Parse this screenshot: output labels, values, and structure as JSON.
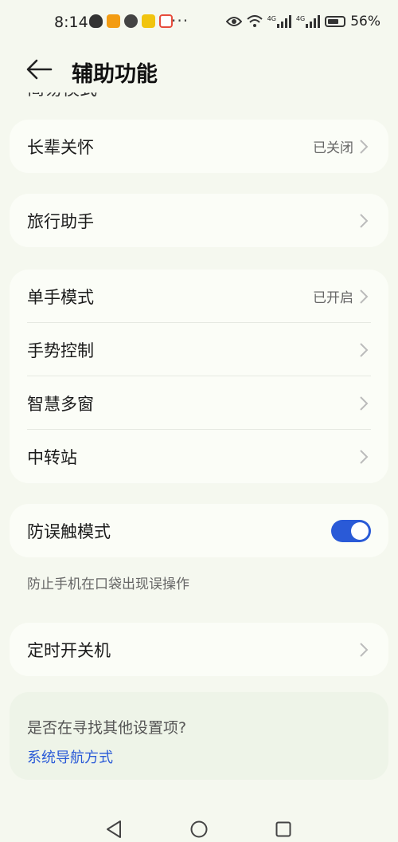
{
  "status_bar": {
    "time": "8:14",
    "dots": "···",
    "net1": "4G",
    "net2": "4G",
    "battery": "56%"
  },
  "header": {
    "title": "辅助功能"
  },
  "cut_off_text": "简易模式",
  "groups": {
    "elder": {
      "label": "长辈关怀",
      "value": "已关闭"
    },
    "travel": {
      "label": "旅行助手"
    },
    "one_hand": {
      "label": "单手模式",
      "value": "已开启"
    },
    "gesture": {
      "label": "手势控制"
    },
    "multi_window": {
      "label": "智慧多窗"
    },
    "transfer": {
      "label": "中转站"
    },
    "anti_touch": {
      "label": "防误触模式",
      "enabled": true,
      "hint": "防止手机在口袋出现误操作"
    },
    "timer_power": {
      "label": "定时开关机"
    }
  },
  "suggest": {
    "question": "是否在寻找其他设置项?",
    "link": "系统导航方式"
  },
  "colors": {
    "accent": "#2a5ad7",
    "background": "#f5f8ef",
    "card": "#fbfdf7"
  }
}
